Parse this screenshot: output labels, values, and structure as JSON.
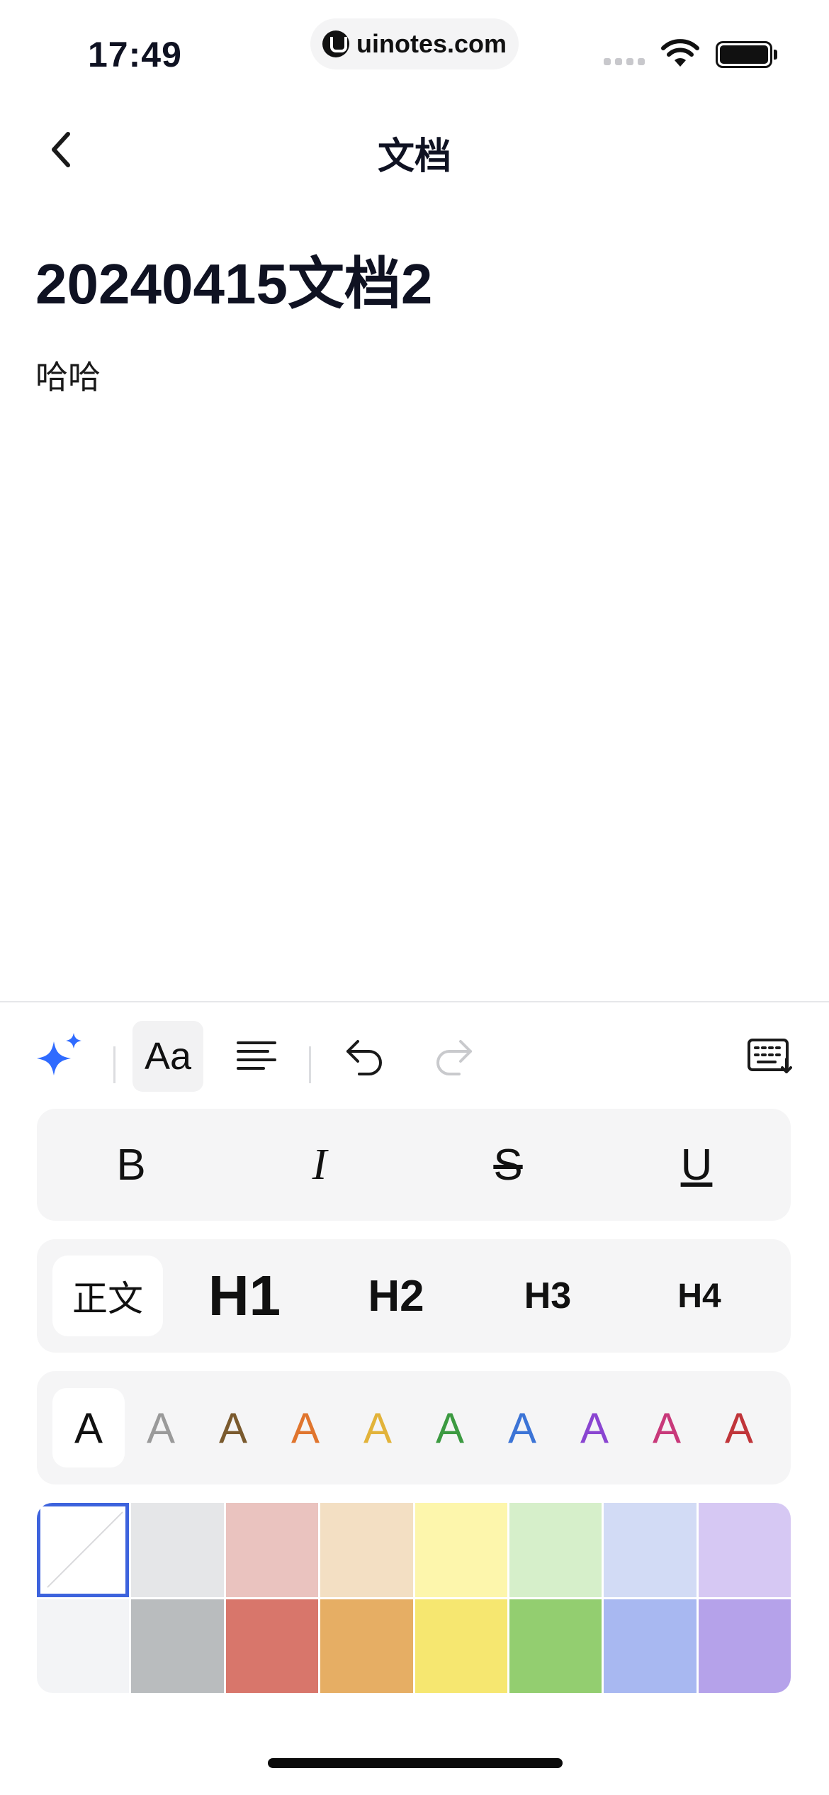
{
  "status_bar": {
    "time": "17:49",
    "url": "uinotes.com"
  },
  "nav": {
    "title": "文档"
  },
  "document": {
    "title": "20240415文档2",
    "body": "哈哈"
  },
  "toolbar": {
    "aa_label": "Aa",
    "accent_color": "#2f6bff"
  },
  "text_styles": {
    "bold": "B",
    "italic": "I",
    "strikethrough": "S",
    "underline": "U"
  },
  "headings": [
    {
      "label": "正文",
      "selected": true
    },
    {
      "label": "H1"
    },
    {
      "label": "H2"
    },
    {
      "label": "H3"
    },
    {
      "label": "H4"
    }
  ],
  "font_colors": [
    {
      "label": "A",
      "color": "#111111",
      "selected": true
    },
    {
      "label": "A",
      "color": "#9a9a9a"
    },
    {
      "label": "A",
      "color": "#7a5a2e"
    },
    {
      "label": "A",
      "color": "#e0752e"
    },
    {
      "label": "A",
      "color": "#e2b33a"
    },
    {
      "label": "A",
      "color": "#3c9a41"
    },
    {
      "label": "A",
      "color": "#3c74d6"
    },
    {
      "label": "A",
      "color": "#8a45d1"
    },
    {
      "label": "A",
      "color": "#c8397a"
    },
    {
      "label": "A",
      "color": "#c0353a"
    }
  ],
  "background_colors": [
    "none",
    "#e5e6e8",
    "#eac3bf",
    "#f3dfc3",
    "#fdf6ac",
    "#d6efca",
    "#d2dbf5",
    "#d6c8f3",
    "#f3f4f6",
    "#b9bcbe",
    "#d8766b",
    "#e6ae64",
    "#f6e770",
    "#93ce70",
    "#a8b8f1",
    "#b5a2ea"
  ]
}
